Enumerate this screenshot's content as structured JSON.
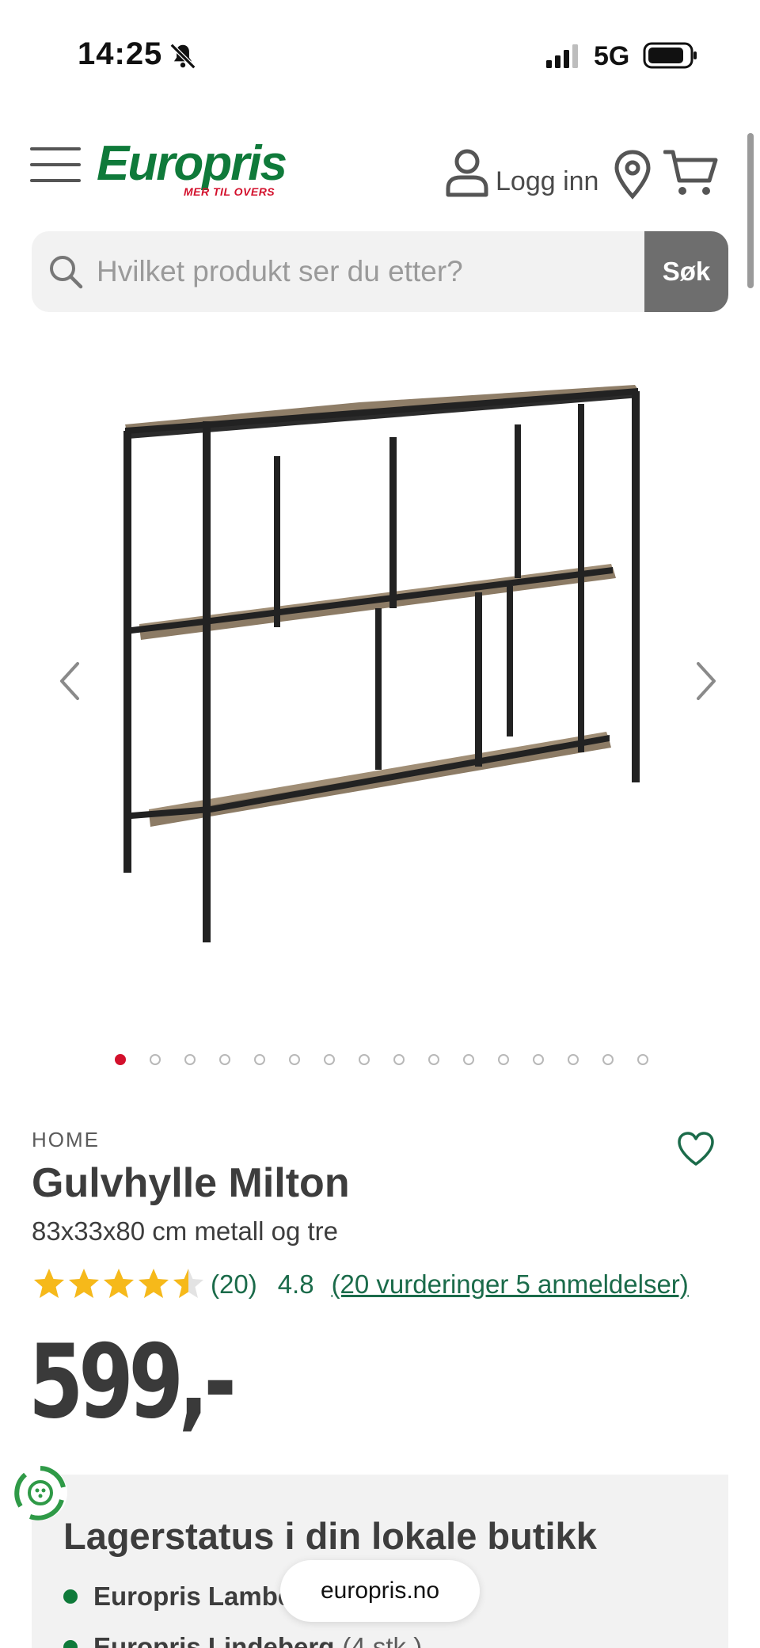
{
  "status_bar": {
    "time": "14:25",
    "network": "5G"
  },
  "header": {
    "logo_text": "Europris",
    "logo_tagline": "MER TIL OVERS",
    "login_label": "Logg inn",
    "brand_color": "#0f7a3a",
    "accent_color": "#d3102c"
  },
  "search": {
    "placeholder": "Hvilket produkt ser du etter?",
    "button_label": "Søk"
  },
  "gallery": {
    "image_count": 16,
    "active_index": 0
  },
  "product": {
    "brand": "HOME",
    "title": "Gulvhylle Milton",
    "subtitle": "83x33x80 cm metall og tre",
    "rating_stars": 4.5,
    "rating_count": "(20)",
    "rating_value": "4.8",
    "reviews_link": "(20 vurderinger 5 anmeldelser)",
    "price": "599,-"
  },
  "stock": {
    "title": "Lagerstatus i din lokale butikk",
    "stores": [
      {
        "name": "Europris Lambe",
        "count": ""
      },
      {
        "name": "Europris Lindeberg",
        "count": "(4 stk.)"
      }
    ]
  },
  "browser": {
    "url": "europris.no"
  }
}
